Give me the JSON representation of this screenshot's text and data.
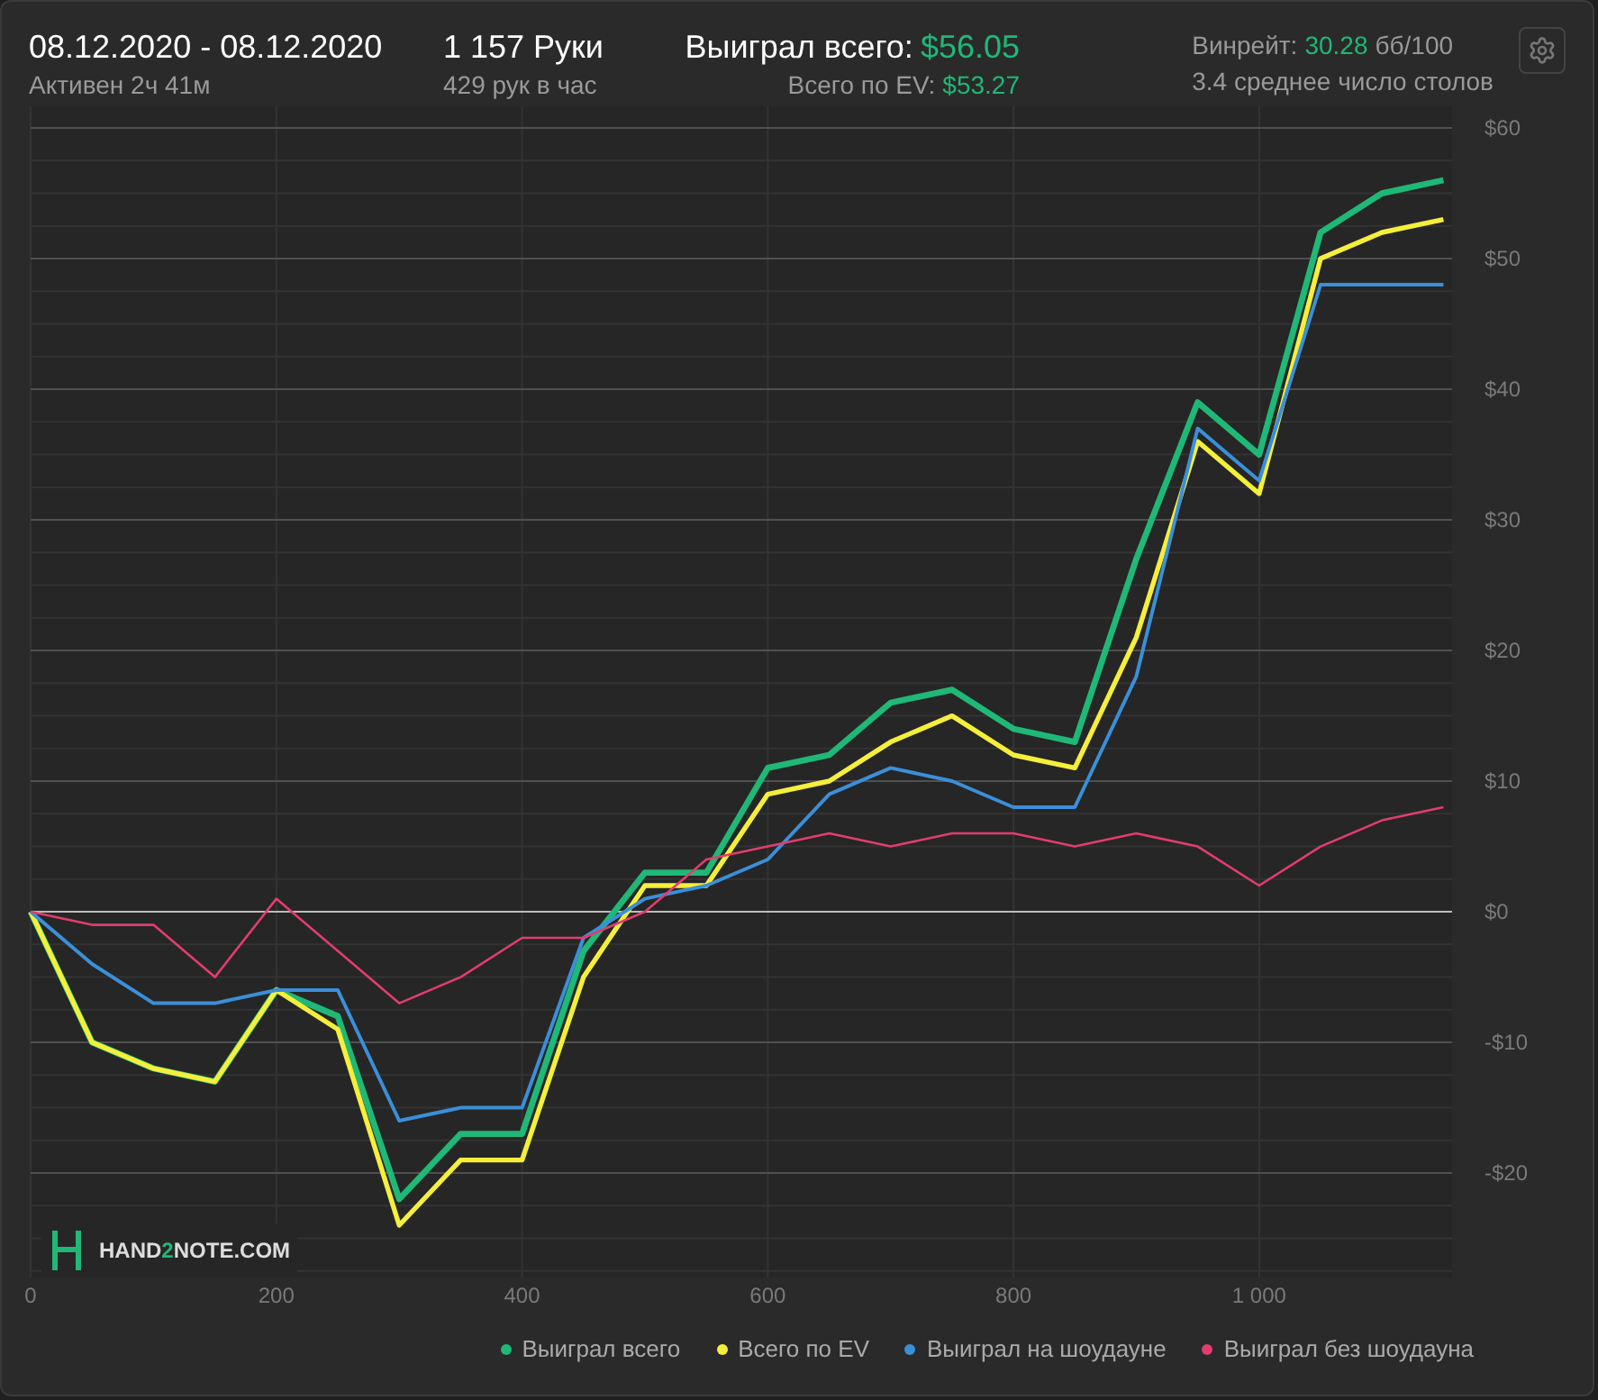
{
  "header": {
    "date_range": "08.12.2020 - 08.12.2020",
    "active_time": "Активен 2ч 41м",
    "hands": "1 157 Руки",
    "hands_per_hour": "429 рук в час",
    "won_label": "Выиграл всего:",
    "won_value": "$56.05",
    "ev_label": "Всего по EV:",
    "ev_value": "$53.27",
    "winrate_label": "Винрейт:",
    "winrate_value": "30.28",
    "winrate_unit": "бб/100",
    "tables": "3.4 среднее число столов"
  },
  "logo": {
    "text_1": "HAND",
    "accent": "2",
    "text_2": "NOTE.COM"
  },
  "chart_data": {
    "type": "line",
    "grid": true,
    "x": [
      0,
      50,
      100,
      150,
      200,
      250,
      300,
      350,
      400,
      450,
      500,
      550,
      600,
      650,
      700,
      750,
      800,
      850,
      900,
      950,
      1000,
      1050,
      1100,
      1150
    ],
    "xlim": [
      0,
      1157
    ],
    "ylim": [
      -28,
      60
    ],
    "xticks": [
      0,
      200,
      400,
      600,
      800,
      {
        "value": 1000,
        "label": "1 000"
      }
    ],
    "yticks": [
      {
        "value": -20,
        "label": "-$20"
      },
      {
        "value": -10,
        "label": "-$10"
      },
      {
        "value": 0,
        "label": "$0"
      },
      {
        "value": 10,
        "label": "$10"
      },
      {
        "value": 20,
        "label": "$20"
      },
      {
        "value": 30,
        "label": "$30"
      },
      {
        "value": 40,
        "label": "$40"
      },
      {
        "value": 50,
        "label": "$50"
      },
      {
        "value": 60,
        "label": "$60"
      }
    ],
    "series": [
      {
        "name": "Выиграл всего",
        "color": "#1fb877",
        "values": [
          0,
          -10,
          -12,
          -13,
          -6,
          -8,
          -22,
          -17,
          -17,
          -3,
          3,
          3,
          11,
          12,
          16,
          17,
          14,
          13,
          27,
          39,
          35,
          52,
          55,
          56
        ]
      },
      {
        "name": "Всего по EV",
        "color": "#f5ef3b",
        "values": [
          0,
          -10,
          -12,
          -13,
          -6,
          -9,
          -24,
          -19,
          -19,
          -5,
          2,
          2,
          9,
          10,
          13,
          15,
          12,
          11,
          21,
          36,
          32,
          50,
          52,
          53
        ]
      },
      {
        "name": "Выиграл на шоудауне",
        "color": "#3b8fd9",
        "values": [
          0,
          -4,
          -7,
          -7,
          -6,
          -6,
          -16,
          -15,
          -15,
          -2,
          1,
          2,
          4,
          9,
          11,
          10,
          8,
          8,
          18,
          37,
          33,
          48,
          48,
          48
        ]
      },
      {
        "name": "Выиграл без шоудауна",
        "color": "#e23d6e",
        "values": [
          0,
          -1,
          -1,
          -5,
          1,
          -3,
          -7,
          -5,
          -2,
          -2,
          0,
          4,
          5,
          6,
          5,
          6,
          6,
          5,
          6,
          5,
          2,
          5,
          7,
          8
        ]
      }
    ]
  }
}
